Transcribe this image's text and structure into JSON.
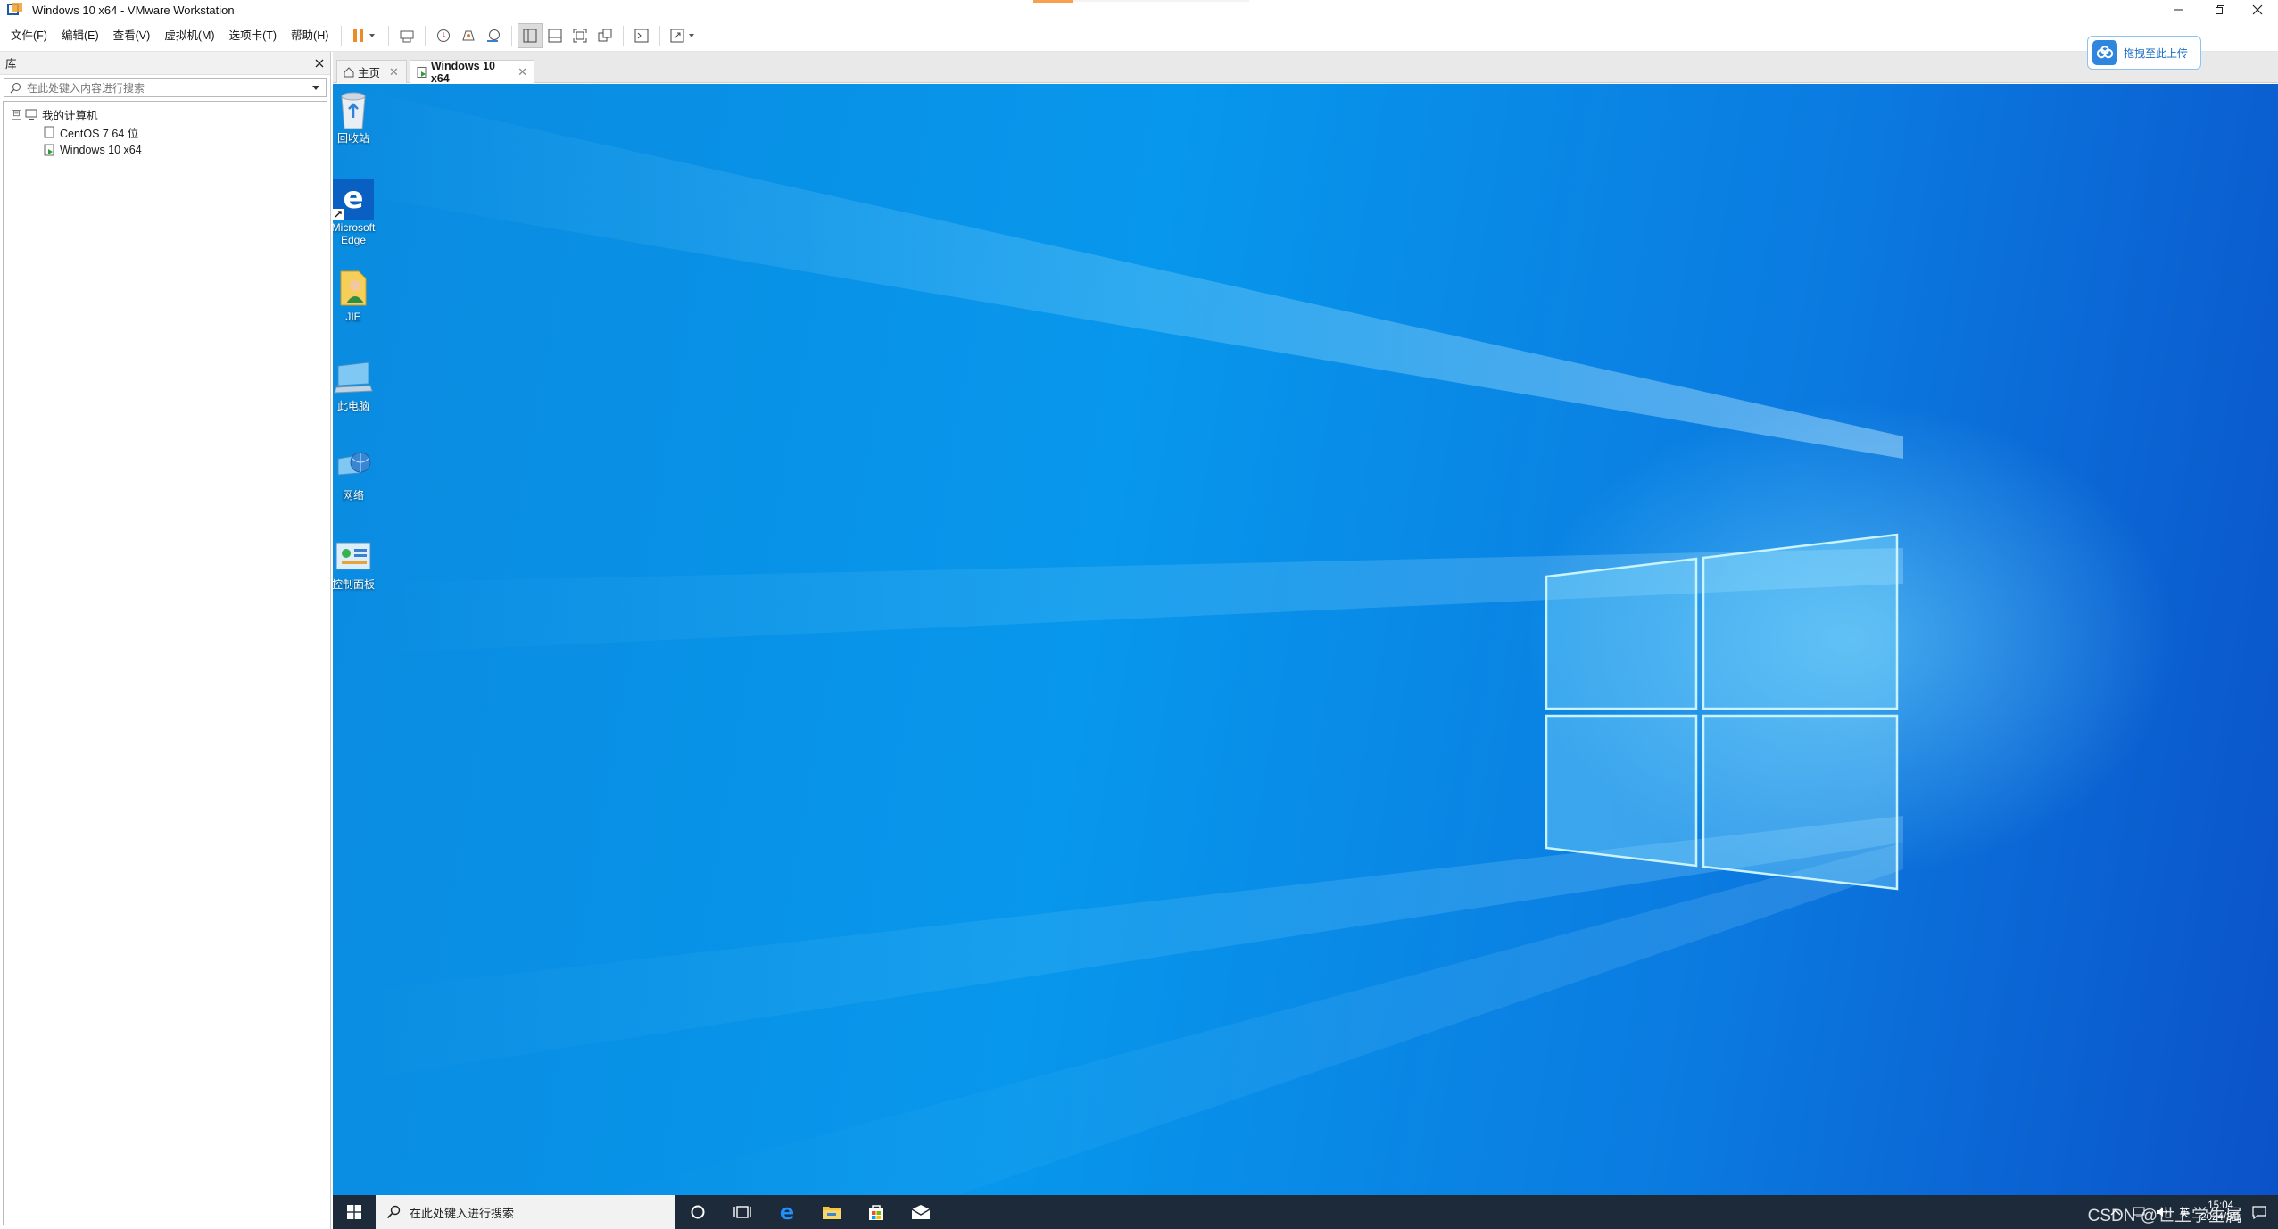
{
  "window": {
    "title": "Windows 10 x64 - VMware Workstation",
    "controls": {
      "minimize_icon": "minimize-icon",
      "restore_icon": "restore-icon",
      "close_icon": "close-icon"
    }
  },
  "menubar": {
    "items": [
      "文件(F)",
      "编辑(E)",
      "查看(V)",
      "虚拟机(M)",
      "选项卡(T)",
      "帮助(H)"
    ]
  },
  "toolbar": {
    "icons": [
      "pause-icon",
      "send-ctrl-alt-del-icon",
      "snapshot-icon",
      "revert-snapshot-icon",
      "snapshot-manager-icon",
      "show-library-icon",
      "thumbnail-bar-icon",
      "full-screen-icon",
      "unity-icon",
      "console-view-icon",
      "stretch-icon"
    ]
  },
  "library": {
    "header": "库",
    "search_placeholder": "在此处键入内容进行搜索",
    "tree": [
      {
        "label": "我的计算机",
        "expander": "⊟"
      },
      {
        "label": "CentOS 7 64 位"
      },
      {
        "label": "Windows 10 x64"
      }
    ]
  },
  "tabs": [
    {
      "label": "主页"
    },
    {
      "label": "Windows 10 x64"
    }
  ],
  "upload": {
    "label": "拖拽至此上传"
  },
  "desktop": {
    "icons": [
      {
        "label": "回收站",
        "icon": "recycle-bin-icon"
      },
      {
        "label": "Microsoft Edge",
        "icon": "edge-icon"
      },
      {
        "label": "JIE",
        "icon": "user-folder-icon"
      },
      {
        "label": "此电脑",
        "icon": "this-pc-icon"
      },
      {
        "label": "网络",
        "icon": "network-icon"
      },
      {
        "label": "控制面板",
        "icon": "control-panel-icon"
      }
    ]
  },
  "taskbar": {
    "search_placeholder": "在此处键入进行搜索",
    "tray": {
      "lang": "英",
      "time": "15:04",
      "date": "2024/3/1"
    },
    "watermark": "CSDN @世上学生属"
  },
  "colors": {
    "desktop_blue": "#0797ec",
    "taskbar": "#1c2a39",
    "pause_orange": "#f08a24"
  }
}
